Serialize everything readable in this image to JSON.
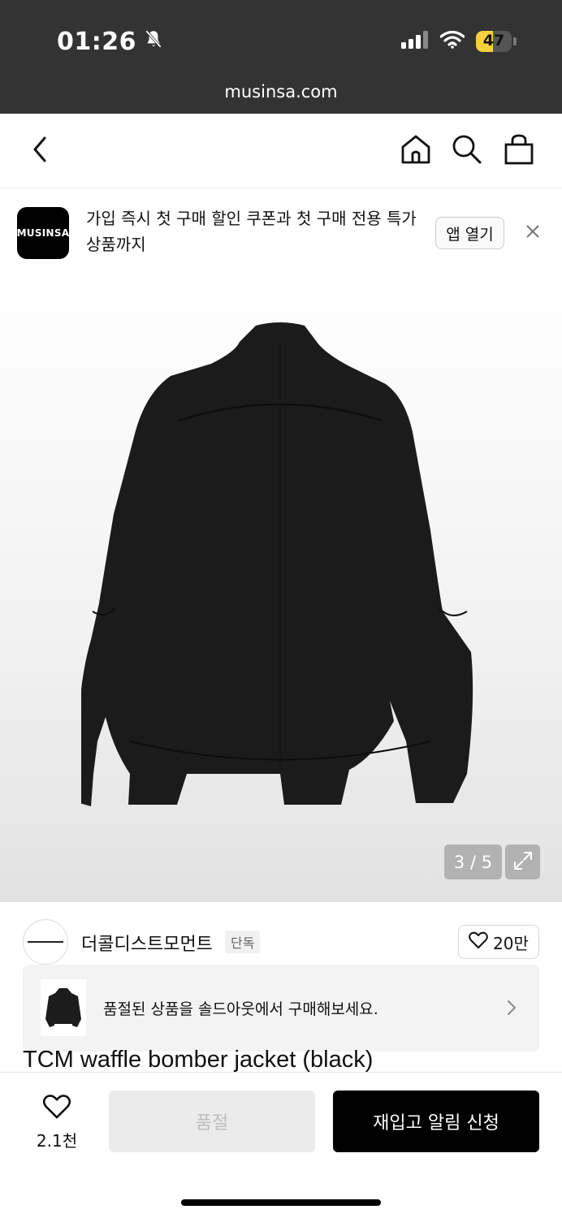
{
  "status_bar": {
    "time": "01:26",
    "battery": "47",
    "battery_level_percent": 47,
    "url": "musinsa.com",
    "battery_color": "#f4d03f"
  },
  "nav": {
    "icons": [
      "back-icon",
      "home-icon",
      "search-icon",
      "shopping-bag-icon"
    ]
  },
  "app_banner": {
    "logo_text": "MUSINSA",
    "message": "가입 즉시 첫 구매 할인 쿠폰과 첫 구매 전용 특가 상품까지",
    "open_button": "앱 열기"
  },
  "gallery": {
    "counter": "3 / 5"
  },
  "brand": {
    "name": "더콜디스트모먼트",
    "badge": "단독",
    "likes": "20만"
  },
  "soldout_banner": {
    "text": "품절된 상품을 솔드아웃에서 구매해보세요."
  },
  "product": {
    "title": "TCM waffle bomber jacket (black)"
  },
  "bottom_bar": {
    "wish_count": "2.1천",
    "soldout_label": "품절",
    "restock_label": "재입고 알림 신청"
  }
}
